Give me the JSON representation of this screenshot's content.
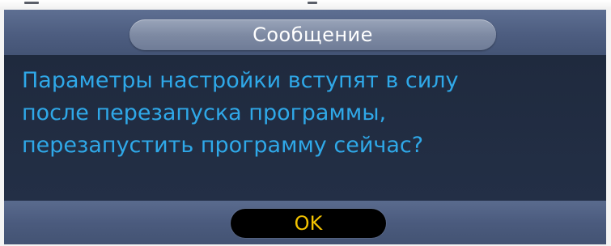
{
  "dialog": {
    "title": "Сообщение",
    "message": "Параметры настройки вступят в силу\nпосле перезапуска программы,\nперезапустить программу сейчас?",
    "ok_label": "OK"
  },
  "colors": {
    "dialog_background": "#253046",
    "title_bar": "#4d5d80",
    "title_pill": "#7e8aa3",
    "message_text": "#2fa8e8",
    "ok_button_background": "#000000",
    "ok_button_text": "#f2c200"
  }
}
